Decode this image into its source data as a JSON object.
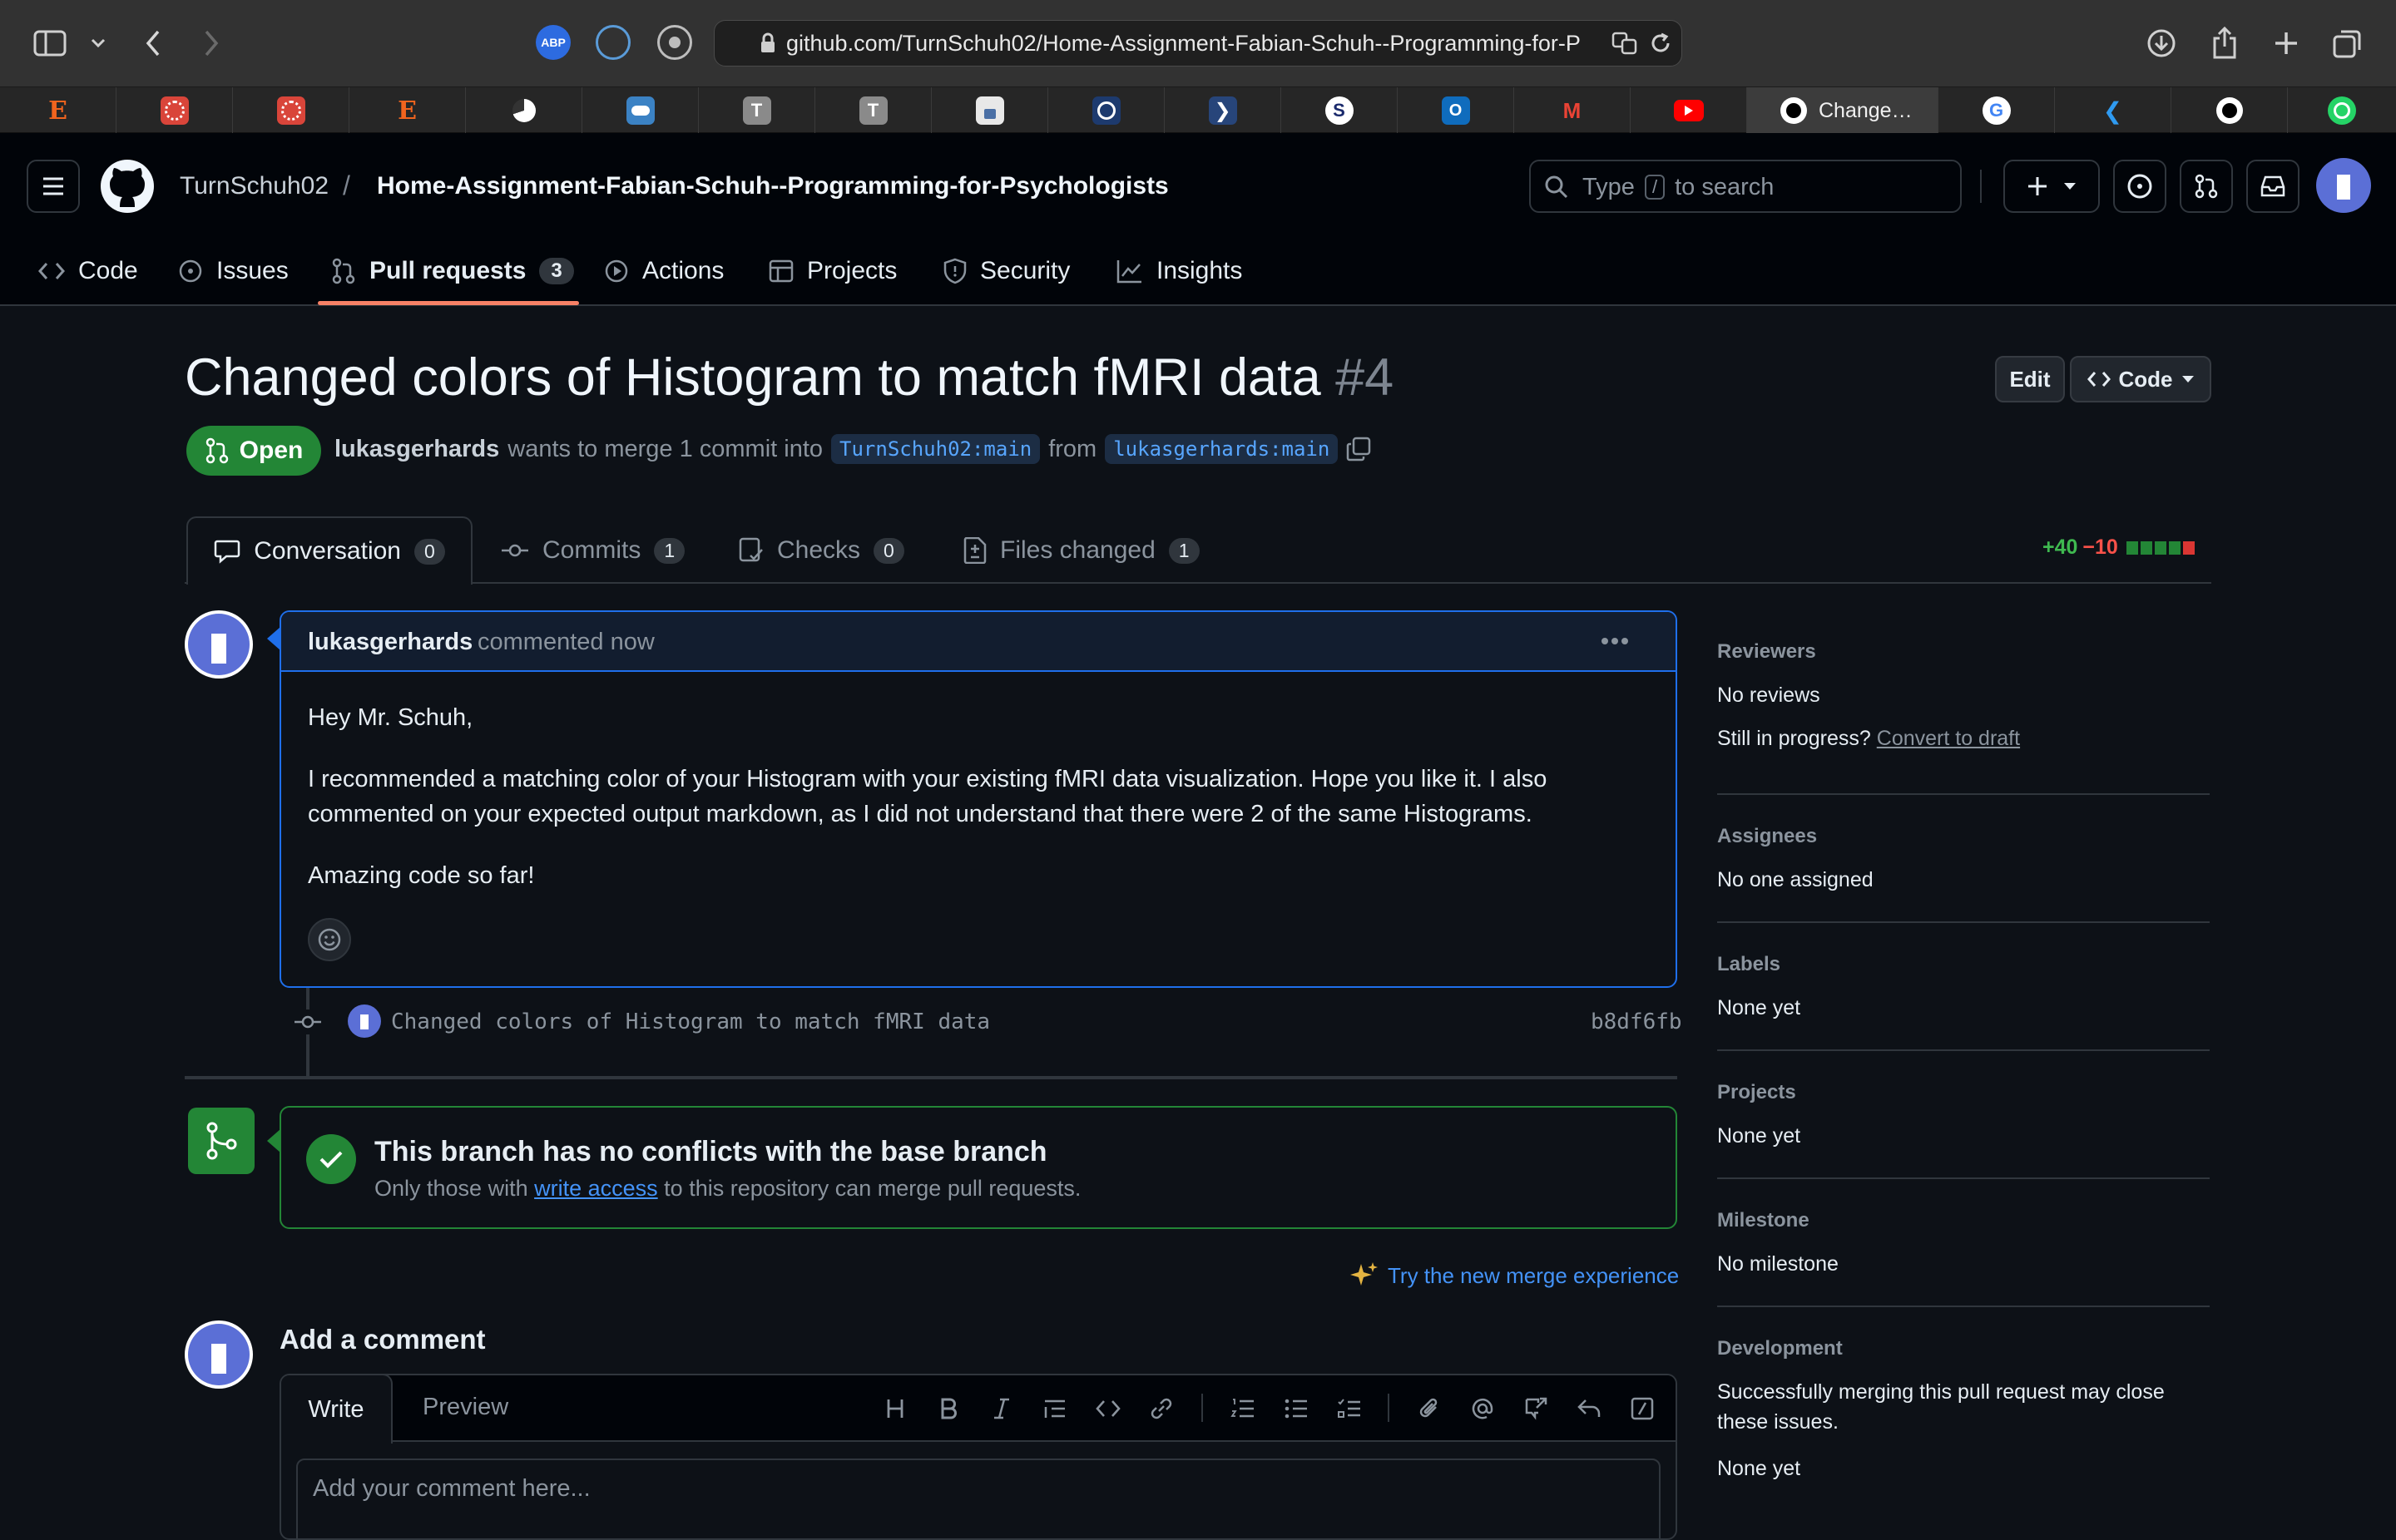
{
  "browser": {
    "url": "github.com/TurnSchuh02/Home-Assignment-Fabian-Schuh--Programming-for-P",
    "active_tab_title": "Change…",
    "favorite_tabs": [
      "etsy",
      "pattern",
      "pattern",
      "etsy",
      "pie",
      "cloud",
      "T",
      "T",
      "lock",
      "O",
      "arrow",
      "S",
      "outlook",
      "gmail",
      "youtube",
      "github",
      "google",
      "vscode",
      "github",
      "whatsapp"
    ]
  },
  "header": {
    "owner": "TurnSchuh02",
    "separator": "/",
    "repo": "Home-Assignment-Fabian-Schuh--Programming-for-Psychologists",
    "search_prefix": "Type",
    "search_key": "/",
    "search_suffix": "to search"
  },
  "repo_nav": {
    "code": "Code",
    "issues": "Issues",
    "pull_requests": "Pull requests",
    "pull_requests_count": "3",
    "actions": "Actions",
    "projects": "Projects",
    "security": "Security",
    "insights": "Insights"
  },
  "pr": {
    "title": "Changed colors of Histogram to match fMRI data",
    "number": "#4",
    "edit_label": "Edit",
    "code_label": "Code",
    "state": "Open",
    "author": "lukasgerhards",
    "merge_text": "wants to merge 1 commit into",
    "base_branch": "TurnSchuh02:main",
    "from_text": "from",
    "head_branch": "lukasgerhards:main",
    "additions": "+40",
    "deletions": "−10"
  },
  "pr_tabs": {
    "conversation": "Conversation",
    "conversation_count": "0",
    "commits": "Commits",
    "commits_count": "1",
    "checks": "Checks",
    "checks_count": "0",
    "files": "Files changed",
    "files_count": "1"
  },
  "comment": {
    "author": "lukasgerhards",
    "time": "commented now",
    "greeting": "Hey Mr. Schuh,",
    "body_line1": "I recommended a matching color of your Histogram with your existing fMRI data visualization. Hope you like it. I also",
    "body_line2": "commented on your expected output markdown, as I did not understand that there were 2 of the same Histograms.",
    "closing": "Amazing code so far!"
  },
  "commit": {
    "message": "Changed colors of Histogram to match fMRI data",
    "sha": "b8df6fb"
  },
  "merge": {
    "title": "This branch has no conflicts with the base branch",
    "sub_prefix": "Only those with",
    "sub_link": "write access",
    "sub_suffix": "to this repository can merge pull requests.",
    "new_experience": "Try the new merge experience"
  },
  "add_comment": {
    "title": "Add a comment",
    "tab_write": "Write",
    "tab_preview": "Preview",
    "placeholder": "Add your comment here..."
  },
  "sidebar": {
    "reviewers_head": "Reviewers",
    "reviewers_val": "No reviews",
    "progress_text": "Still in progress?",
    "progress_link": "Convert to draft",
    "assignees_head": "Assignees",
    "assignees_val": "No one assigned",
    "labels_head": "Labels",
    "labels_val": "None yet",
    "projects_head": "Projects",
    "projects_val": "None yet",
    "milestone_head": "Milestone",
    "milestone_val": "No milestone",
    "development_head": "Development",
    "development_line1": "Successfully merging this pull request may close",
    "development_line2": "these issues.",
    "development_val": "None yet"
  },
  "colors": {
    "accent": "#1f6feb",
    "success": "#238636",
    "danger": "#da3633",
    "link": "#4493f8"
  }
}
